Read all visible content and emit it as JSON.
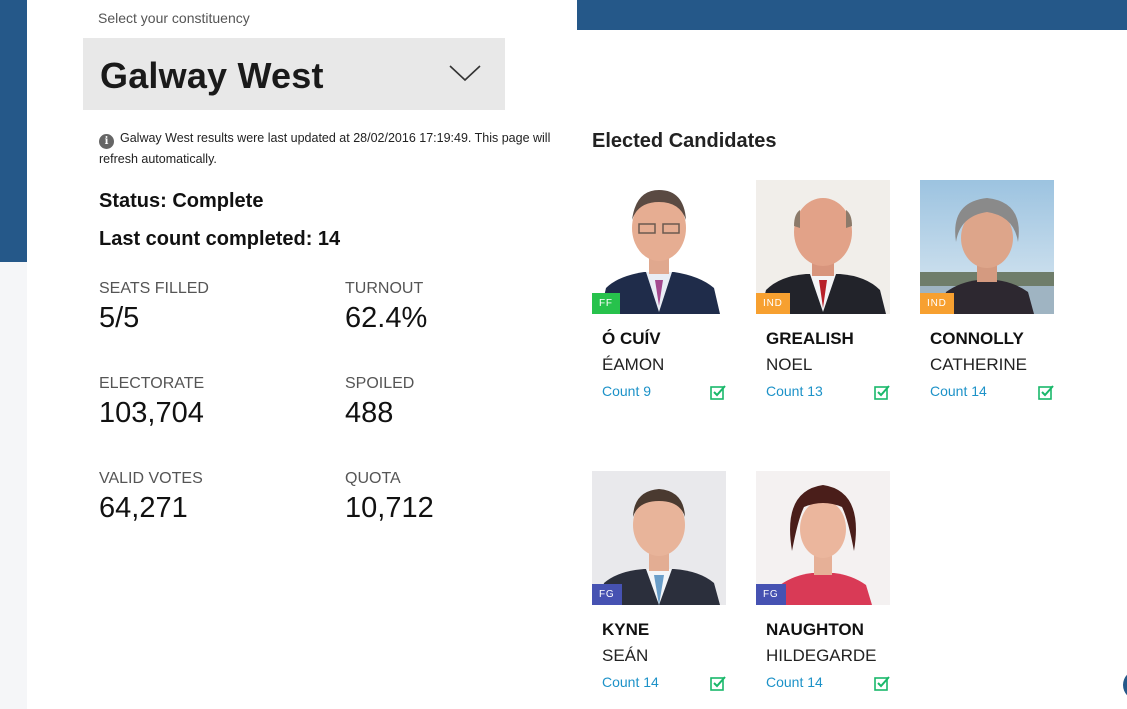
{
  "constituency": {
    "label": "Select your constituency",
    "selected": "Galway West"
  },
  "notice": "Galway West results were last updated at 28/02/2016 17:19:49. This page will refresh automatically.",
  "status_line": "Status: Complete",
  "last_count_line": "Last count completed: 14",
  "stats": [
    {
      "label": "SEATS FILLED",
      "value": "5/5"
    },
    {
      "label": "TURNOUT",
      "value": "62.4%"
    },
    {
      "label": "ELECTORATE",
      "value": "103,704"
    },
    {
      "label": "SPOILED",
      "value": "488"
    },
    {
      "label": "VALID VOTES",
      "value": "64,271"
    },
    {
      "label": "QUOTA",
      "value": "10,712"
    }
  ],
  "elected_heading": "Elected Candidates",
  "candidates": [
    {
      "party": "FF",
      "party_color": "#27c24c",
      "surname": "Ó CUÍV",
      "firstname": "ÉAMON",
      "count": "Count 9"
    },
    {
      "party": "IND",
      "party_color": "#f7a030",
      "surname": "GREALISH",
      "firstname": "NOEL",
      "count": "Count 13"
    },
    {
      "party": "IND",
      "party_color": "#f7a030",
      "surname": "CONNOLLY",
      "firstname": "CATHERINE",
      "count": "Count 14"
    },
    {
      "party": "FG",
      "party_color": "#4652b2",
      "surname": "KYNE",
      "firstname": "SEÁN",
      "count": "Count 14"
    },
    {
      "party": "FG",
      "party_color": "#4652b2",
      "surname": "NAUGHTON",
      "firstname": "HILDEGARDE",
      "count": "Count 14"
    }
  ],
  "colors": {
    "brand_blue": "#255889",
    "count_link": "#1d92c8",
    "elected_check": "#19b86a",
    "select_bg": "#e8e8e8"
  },
  "icons": {
    "dropdown": "chevron-down-icon",
    "info": "info-icon",
    "elected": "checked-box-icon"
  }
}
